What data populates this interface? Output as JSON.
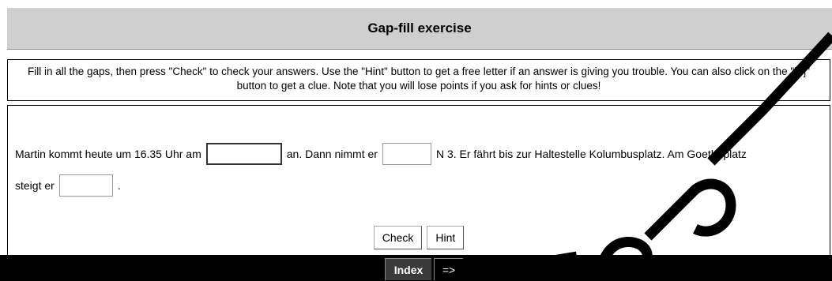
{
  "title": "Gap-fill exercise",
  "instructions": "Fill in all the gaps, then press \"Check\" to check your answers. Use the \"Hint\" button to get a free letter if an answer is giving you trouble. You can also click on the \"[?]\" button to get a clue. Note that you will lose points if you ask for hints or clues!",
  "exercise": {
    "seg1": "Martin kommt heute um 16.35 Uhr am",
    "seg2": "an. Dann nimmt er",
    "seg3": "N 3. Er fährt bis zur Haltestelle Kolumbusplatz. Am Goetheplatz",
    "seg4": "steigt er",
    "seg5": ".",
    "gap1_value": "",
    "gap2_value": "",
    "gap3_value": ""
  },
  "buttons": {
    "check": "Check",
    "hint": "Hint"
  },
  "nav": {
    "index": "Index",
    "next": "=>"
  }
}
